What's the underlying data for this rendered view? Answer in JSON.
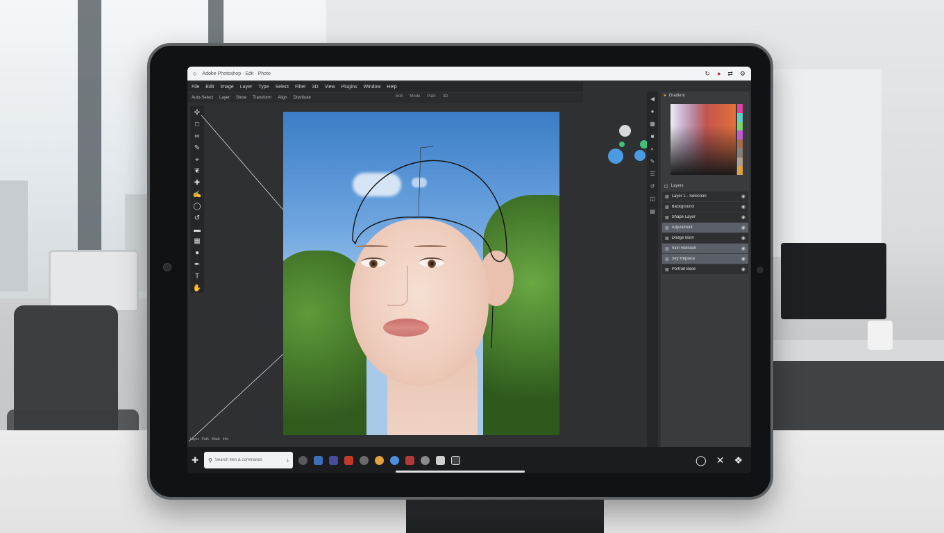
{
  "browser": {
    "address": "Adobe Photoshop · Edit · Photo",
    "icons": [
      "reload-icon",
      "profile-icon",
      "share-icon",
      "settings-icon"
    ]
  },
  "menu": [
    "File",
    "Edit",
    "Image",
    "Layer",
    "Type",
    "Select",
    "Filter",
    "3D",
    "View",
    "Plugins",
    "Window",
    "Help"
  ],
  "options": [
    "Auto-Select",
    "Layer",
    "Show",
    "Transform",
    "Align",
    "Distribute"
  ],
  "options_center": [
    "Edit",
    "Mode",
    "Path",
    "3D"
  ],
  "tools": [
    "move-icon",
    "marquee-icon",
    "lasso-icon",
    "quick-select-icon",
    "crop-icon",
    "eyedropper-icon",
    "healing-icon",
    "brush-icon",
    "stamp-icon",
    "history-icon",
    "eraser-icon",
    "gradient-icon",
    "dodge-icon",
    "pen-icon",
    "type-icon",
    "hand-icon"
  ],
  "right_panel": {
    "color_title": "Gradient",
    "layers_title": "Layers",
    "layers": [
      {
        "name": "Layer 1 - Selection",
        "selected": false
      },
      {
        "name": "Background",
        "selected": false
      },
      {
        "name": "Shape Layer",
        "selected": false
      },
      {
        "name": "Adjustment",
        "selected": true
      },
      {
        "name": "Dodge Burn",
        "selected": false
      },
      {
        "name": "Skin Retouch",
        "selected": true
      },
      {
        "name": "Sky Replace",
        "selected": true
      },
      {
        "name": "Portrait Base",
        "selected": false
      }
    ]
  },
  "bottom_tabs": [
    "Layer",
    "Path",
    "Mask",
    "Info"
  ],
  "taskbar": {
    "search_placeholder": "Search files & commands",
    "dock_colors": [
      "#5a5a5a",
      "#3d6fb8",
      "#4a4d9e",
      "#c0392b",
      "#6a6a6a",
      "#e4a23a",
      "#4a8fe0",
      "#b23a3a",
      "#8a8a8a",
      "#d0d0d0",
      "#444444"
    ]
  },
  "colors": {
    "panel_bg": "#3a3b3e",
    "selection_line": "#111111",
    "accent_blue": "#4b9be3",
    "accent_red": "#e0374d",
    "accent_green": "#3fc07a"
  }
}
